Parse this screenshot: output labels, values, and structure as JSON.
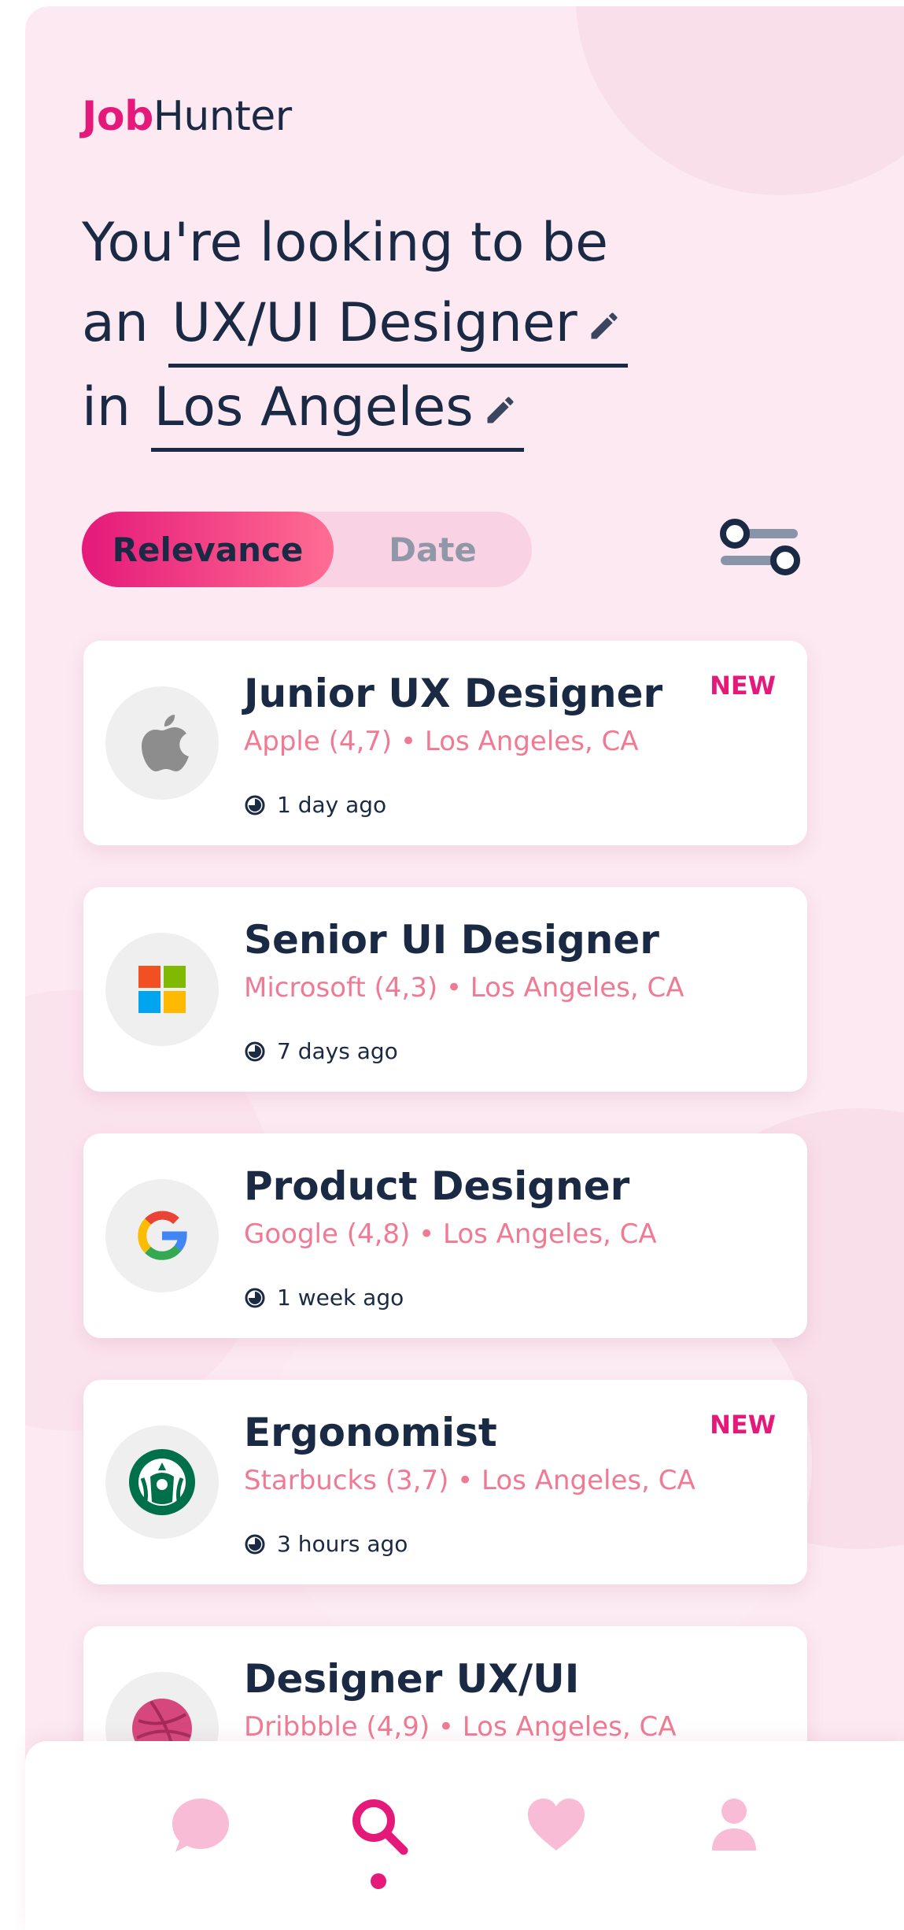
{
  "brand": {
    "part1": "Job",
    "part2": "Hunter"
  },
  "search": {
    "prefix": "You're looking to be",
    "role_prefix": "an",
    "role": "UX/UI Designer",
    "location_prefix": "in",
    "location": "Los Angeles"
  },
  "sort": {
    "active": "Relevance",
    "other": "Date"
  },
  "jobs": [
    {
      "title": "Junior UX Designer",
      "company": "Apple (4,7) • Los Angeles, CA",
      "time": "1 day ago",
      "badge": "NEW",
      "logo": "apple-logo"
    },
    {
      "title": "Senior UI Designer",
      "company": "Microsoft (4,3) • Los Angeles, CA",
      "time": "7 days ago",
      "badge": "",
      "logo": "microsoft-logo"
    },
    {
      "title": "Product Designer",
      "company": "Google (4,8) • Los Angeles, CA",
      "time": "1 week ago",
      "badge": "",
      "logo": "google-logo"
    },
    {
      "title": "Ergonomist",
      "company": "Starbucks (3,7) • Los Angeles, CA",
      "time": "3 hours ago",
      "badge": "NEW",
      "logo": "starbucks-logo"
    },
    {
      "title": "Designer UX/UI",
      "company": "Dribbble (4,9) • Los Angeles, CA",
      "time": "",
      "badge": "",
      "logo": "dribbble-logo"
    }
  ],
  "nav": {
    "items": [
      "chat-icon",
      "search-icon",
      "heart-icon",
      "profile-icon"
    ],
    "active": "search-icon"
  },
  "colors": {
    "accent": "#e5197a",
    "navy": "#1b2a44",
    "salmon": "#f07a93",
    "background": "#fce9f1"
  }
}
